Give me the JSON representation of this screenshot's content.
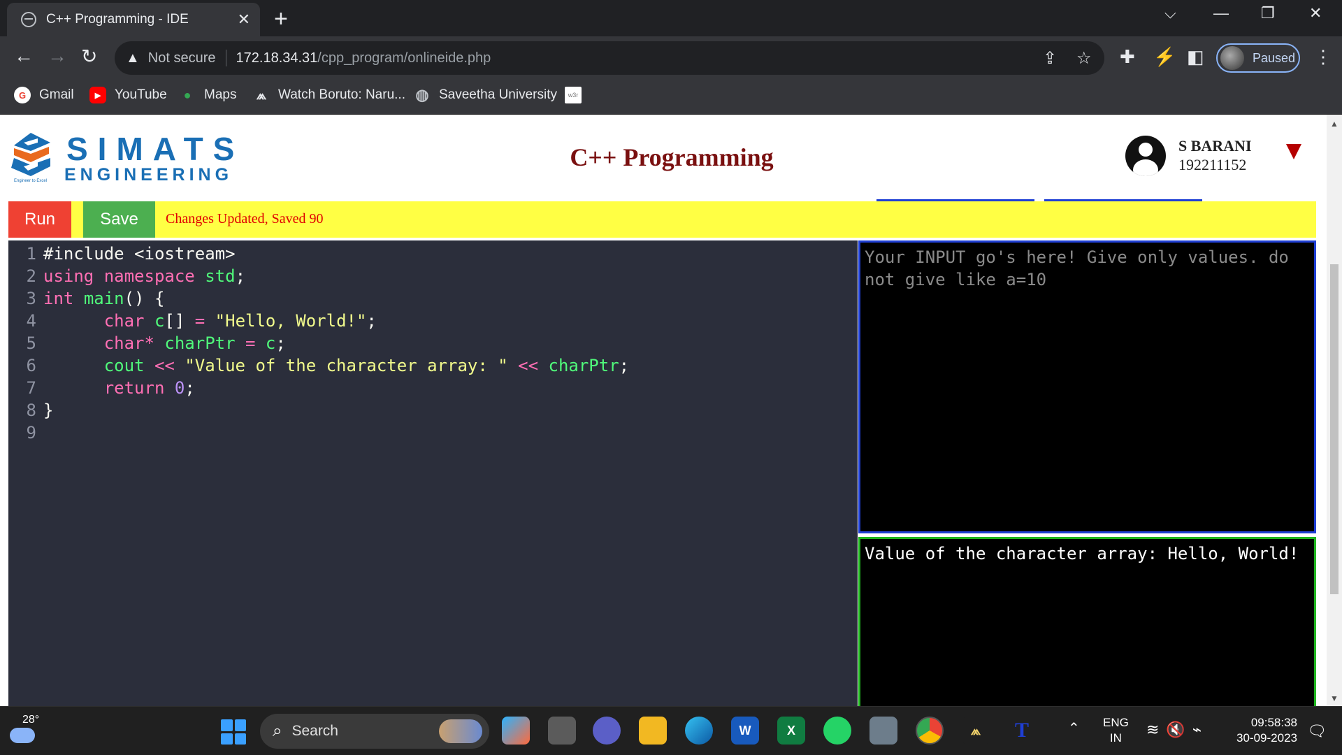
{
  "browser": {
    "tab_title": "C++ Programming - IDE",
    "tab_close": "✕",
    "new_tab": "+",
    "window_controls": [
      "⌵",
      "—",
      "❐",
      "✕"
    ],
    "security_label": "Not secure",
    "url_host": "172.18.34.31",
    "url_path": "/cpp_program/onlineide.php",
    "profile_status": "Paused",
    "bookmarks": [
      {
        "label": "Gmail",
        "icon": "google-icon",
        "color": "#ea4335",
        "glyph": "G"
      },
      {
        "label": "YouTube",
        "icon": "youtube-icon",
        "color": "#ff0000",
        "glyph": "▶"
      },
      {
        "label": "Maps",
        "icon": "maps-icon",
        "color": "#34a853",
        "glyph": "●"
      },
      {
        "label": "Watch Boruto: Naru...",
        "icon": "anime-site-icon",
        "color": "#35363a",
        "glyph": "⩕"
      },
      {
        "label": "Saveetha University",
        "icon": "globe-icon",
        "color": "#5f6368",
        "glyph": "◍"
      },
      {
        "label": "",
        "icon": "w3r-icon",
        "color": "#ffffff",
        "glyph": "w3r"
      }
    ]
  },
  "page": {
    "logo_word1": "SIMATS",
    "logo_word2": "ENGINEERING",
    "logo_tagline": "Engineer to Excel",
    "title": "C++ Programming",
    "user_name": "S BARANI",
    "user_id": "192211152",
    "run_label": "Run",
    "save_label": "Save",
    "status_message": "Changes Updated, Saved 90",
    "code_lines": [
      {
        "num": "1",
        "tokens": [
          {
            "t": "#include <iostream>",
            "c": "c-pre"
          }
        ]
      },
      {
        "num": "2",
        "tokens": [
          {
            "t": "using",
            "c": "c-kw"
          },
          {
            "t": " ",
            "c": "c-plain"
          },
          {
            "t": "namespace",
            "c": "c-kw"
          },
          {
            "t": " ",
            "c": "c-plain"
          },
          {
            "t": "std",
            "c": "c-id"
          },
          {
            "t": ";",
            "c": "c-plain"
          }
        ]
      },
      {
        "num": "3",
        "tokens": [
          {
            "t": "int",
            "c": "c-type"
          },
          {
            "t": " ",
            "c": "c-plain"
          },
          {
            "t": "main",
            "c": "c-id"
          },
          {
            "t": "() {",
            "c": "c-plain"
          }
        ]
      },
      {
        "num": "4",
        "tokens": [
          {
            "t": "      ",
            "c": "c-plain"
          },
          {
            "t": "char",
            "c": "c-type"
          },
          {
            "t": " ",
            "c": "c-plain"
          },
          {
            "t": "c",
            "c": "c-id"
          },
          {
            "t": "[] ",
            "c": "c-plain"
          },
          {
            "t": "=",
            "c": "c-kw"
          },
          {
            "t": " ",
            "c": "c-plain"
          },
          {
            "t": "\"Hello, World!\"",
            "c": "c-str"
          },
          {
            "t": ";",
            "c": "c-plain"
          }
        ]
      },
      {
        "num": "5",
        "tokens": [
          {
            "t": "      ",
            "c": "c-plain"
          },
          {
            "t": "char*",
            "c": "c-type"
          },
          {
            "t": " ",
            "c": "c-plain"
          },
          {
            "t": "charPtr",
            "c": "c-id"
          },
          {
            "t": " ",
            "c": "c-plain"
          },
          {
            "t": "=",
            "c": "c-kw"
          },
          {
            "t": " ",
            "c": "c-plain"
          },
          {
            "t": "c",
            "c": "c-id"
          },
          {
            "t": ";",
            "c": "c-plain"
          }
        ]
      },
      {
        "num": "6",
        "tokens": [
          {
            "t": "      ",
            "c": "c-plain"
          },
          {
            "t": "cout",
            "c": "c-id"
          },
          {
            "t": " ",
            "c": "c-plain"
          },
          {
            "t": "<<",
            "c": "c-kw"
          },
          {
            "t": " ",
            "c": "c-plain"
          },
          {
            "t": "\"Value of the character array: \"",
            "c": "c-str"
          },
          {
            "t": " ",
            "c": "c-plain"
          },
          {
            "t": "<<",
            "c": "c-kw"
          },
          {
            "t": " ",
            "c": "c-plain"
          },
          {
            "t": "charPtr",
            "c": "c-id"
          },
          {
            "t": ";",
            "c": "c-plain"
          }
        ]
      },
      {
        "num": "7",
        "tokens": [
          {
            "t": "      ",
            "c": "c-plain"
          },
          {
            "t": "return",
            "c": "c-kw"
          },
          {
            "t": " ",
            "c": "c-plain"
          },
          {
            "t": "0",
            "c": "c-num"
          },
          {
            "t": ";",
            "c": "c-plain"
          }
        ]
      },
      {
        "num": "8",
        "tokens": [
          {
            "t": "}",
            "c": "c-plain"
          }
        ]
      },
      {
        "num": "9",
        "tokens": []
      }
    ],
    "input_placeholder": "Your INPUT go's here! Give only values. do not give like a=10",
    "output_text": "Value of the character array: Hello, World!"
  },
  "taskbar": {
    "temperature": "28°",
    "search_label": "Search",
    "apps": [
      "copilot-icon",
      "task-view-icon",
      "teams-icon",
      "file-explorer-icon",
      "edge-icon",
      "word-icon",
      "excel-icon",
      "whatsapp-icon",
      "camera-icon",
      "chrome-icon",
      "anime-app-icon",
      "typing-app-icon"
    ],
    "lang_line1": "ENG",
    "lang_line2": "IN",
    "time": "09:58:38",
    "date": "30-09-2023"
  }
}
